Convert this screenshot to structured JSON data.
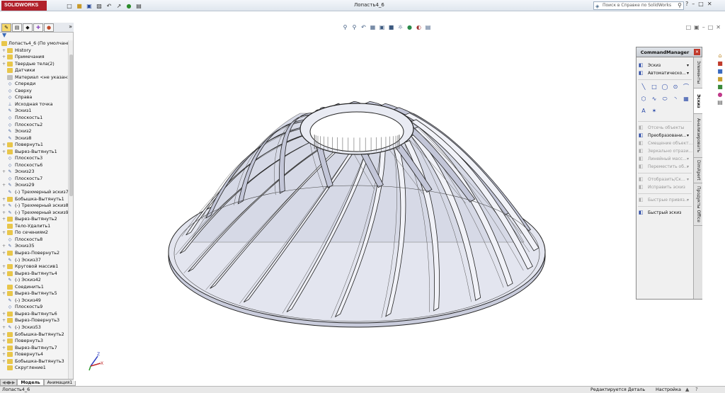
{
  "app": {
    "brand": "SOLIDWORKS",
    "document_title": "Лопасть4_6",
    "search_placeholder": "Поиск в Справке по SolidWorks",
    "toolbar_icons": [
      "new-icon",
      "open-icon",
      "save-icon",
      "print-icon",
      "undo-icon",
      "select-icon",
      "rebuild-icon",
      "options-icon"
    ]
  },
  "feature_manager": {
    "tabs": [
      "feature-manager-tab",
      "property-manager-tab",
      "configuration-manager-tab",
      "dimxpert-tab",
      "display-manager-tab"
    ],
    "root_label": "Лопасть4_6  (По умолчанию",
    "items": [
      {
        "label": "History",
        "icon": "history-icon",
        "expand": true
      },
      {
        "label": "Примечания",
        "icon": "annotations-icon",
        "expand": true
      },
      {
        "label": "Твердые тела(2)",
        "icon": "solid-bodies-icon",
        "expand": true
      },
      {
        "label": "Датчики",
        "icon": "sensors-icon",
        "expand": false
      },
      {
        "label": "Материал <не указан>",
        "icon": "material-icon",
        "expand": false
      },
      {
        "label": "Спереди",
        "icon": "plane-icon",
        "expand": false
      },
      {
        "label": "Сверху",
        "icon": "plane-icon",
        "expand": false
      },
      {
        "label": "Справа",
        "icon": "plane-icon",
        "expand": false
      },
      {
        "label": "Исходная точка",
        "icon": "origin-icon",
        "expand": false
      },
      {
        "label": "Эскиз1",
        "icon": "sketch-icon",
        "expand": false
      },
      {
        "label": "Плоскость1",
        "icon": "plane-icon",
        "expand": false
      },
      {
        "label": "Плоскость2",
        "icon": "plane-icon",
        "expand": false
      },
      {
        "label": "Эскиз2",
        "icon": "sketch-icon",
        "expand": false
      },
      {
        "label": "Эскиз8",
        "icon": "sketch-icon",
        "expand": false
      },
      {
        "label": "Повернуть1",
        "icon": "revolve-icon",
        "expand": true
      },
      {
        "label": "Вырез-Вытянуть1",
        "icon": "cut-extrude-icon",
        "expand": true
      },
      {
        "label": "Плоскость3",
        "icon": "plane-icon",
        "expand": false
      },
      {
        "label": "Плоскость6",
        "icon": "plane-icon",
        "expand": false
      },
      {
        "label": "Эскиз23",
        "icon": "sketch-icon",
        "expand": true
      },
      {
        "label": "Плоскость7",
        "icon": "plane-icon",
        "expand": false
      },
      {
        "label": "Эскиз29",
        "icon": "sketch-icon",
        "expand": true
      },
      {
        "label": "(-) Трехмерный эскиз7",
        "icon": "3d-sketch-icon",
        "expand": false
      },
      {
        "label": "Бобышка-Вытянуть1",
        "icon": "boss-extrude-icon",
        "expand": true
      },
      {
        "label": "(-) Трехмерный эскиз8",
        "icon": "3d-sketch-icon",
        "expand": true
      },
      {
        "label": "(-) Трехмерный эскиз9",
        "icon": "3d-sketch-icon",
        "expand": true
      },
      {
        "label": "Вырез-Вытянуть2",
        "icon": "cut-extrude-icon",
        "expand": true
      },
      {
        "label": "Тело-Удалить1",
        "icon": "delete-body-icon",
        "expand": false
      },
      {
        "label": "По сечениям2",
        "icon": "loft-icon",
        "expand": true
      },
      {
        "label": "Плоскость8",
        "icon": "plane-icon",
        "expand": false
      },
      {
        "label": "Эскиз35",
        "icon": "sketch-icon",
        "expand": true
      },
      {
        "label": "Вырез-Повернуть2",
        "icon": "cut-revolve-icon",
        "expand": true
      },
      {
        "label": "(-) Эскиз37",
        "icon": "sketch-icon",
        "expand": false
      },
      {
        "label": "Круговой массив1",
        "icon": "circular-pattern-icon",
        "expand": true
      },
      {
        "label": "Вырез-Вытянуть4",
        "icon": "cut-extrude-icon",
        "expand": true
      },
      {
        "label": "(-) Эскиз42",
        "icon": "sketch-icon",
        "expand": false
      },
      {
        "label": "Соединить1",
        "icon": "combine-icon",
        "expand": false
      },
      {
        "label": "Вырез-Вытянуть5",
        "icon": "cut-extrude-icon",
        "expand": true
      },
      {
        "label": "(-) Эскиз49",
        "icon": "sketch-icon",
        "expand": false
      },
      {
        "label": "Плоскость9",
        "icon": "plane-icon",
        "expand": false
      },
      {
        "label": "Вырез-Вытянуть6",
        "icon": "cut-extrude-icon",
        "expand": true
      },
      {
        "label": "Вырез-Повернуть3",
        "icon": "cut-revolve-icon",
        "expand": true
      },
      {
        "label": "(-) Эскиз53",
        "icon": "sketch-icon",
        "expand": true
      },
      {
        "label": "Бобышка-Вытянуть2",
        "icon": "boss-extrude-icon",
        "expand": true
      },
      {
        "label": "Повернуть3",
        "icon": "revolve-icon",
        "expand": true
      },
      {
        "label": "Вырез-Вытянуть7",
        "icon": "cut-extrude-icon",
        "expand": true
      },
      {
        "label": "Повернуть4",
        "icon": "revolve-icon",
        "expand": true
      },
      {
        "label": "Бобышка-Вытянуть3",
        "icon": "boss-extrude-icon",
        "expand": true
      },
      {
        "label": "Скругление1",
        "icon": "fillet-icon",
        "expand": false
      }
    ]
  },
  "bottom_tabs": {
    "model": "Модель",
    "annotation": "Анимация1"
  },
  "command_manager": {
    "title": "CommandManager",
    "rows_top": [
      {
        "label": "Эскиз",
        "icon": "sketch-icon",
        "dropdown": true,
        "disabled": false
      },
      {
        "label": "Автоматическо...",
        "icon": "smart-dimension-icon",
        "dropdown": true,
        "disabled": false
      }
    ],
    "tool_icons": [
      "line-icon",
      "rectangle-icon",
      "slot-icon",
      "circle-icon",
      "arc-icon",
      "polygon-icon",
      "spline-icon",
      "ellipse-icon",
      "fillet-sketch-icon",
      "plane-sketch-icon",
      "text-icon",
      "point-icon"
    ],
    "rows_bottom": [
      {
        "label": "Отсечь объекты",
        "icon": "trim-icon",
        "dropdown": false,
        "disabled": true
      },
      {
        "label": "Преобразовани...",
        "icon": "convert-icon",
        "dropdown": true,
        "disabled": false
      },
      {
        "label": "Смещение объект...",
        "icon": "offset-icon",
        "dropdown": false,
        "disabled": true
      },
      {
        "label": "Зеркально отрази...",
        "icon": "mirror-icon",
        "dropdown": false,
        "disabled": true
      },
      {
        "label": "Линейный масс...",
        "icon": "linear-pattern-icon",
        "dropdown": true,
        "disabled": true
      },
      {
        "label": "Переместить об...",
        "icon": "move-icon",
        "dropdown": true,
        "disabled": true
      },
      {
        "label": "Отобразить/Ск...",
        "icon": "display-relations-icon",
        "dropdown": true,
        "disabled": true
      },
      {
        "label": "Исправить эскиз",
        "icon": "repair-icon",
        "dropdown": false,
        "disabled": true
      },
      {
        "label": "Быстрые привяз...",
        "icon": "snaps-icon",
        "dropdown": true,
        "disabled": true
      },
      {
        "label": "Быстрый эскиз",
        "icon": "quick-sketch-icon",
        "dropdown": false,
        "disabled": false
      }
    ],
    "vtabs": [
      "Элементы",
      "Эскиз",
      "Анализировать",
      "DimXpert",
      "Продукты Office"
    ],
    "active_vtab": 1
  },
  "status_bar": {
    "left": "Лопасть4_6",
    "mode": "Редактируется Деталь",
    "units": "Настройка"
  },
  "colors": {
    "accent": "#b1202a",
    "model_face": "#d9dcea",
    "model_edge": "#222222"
  }
}
